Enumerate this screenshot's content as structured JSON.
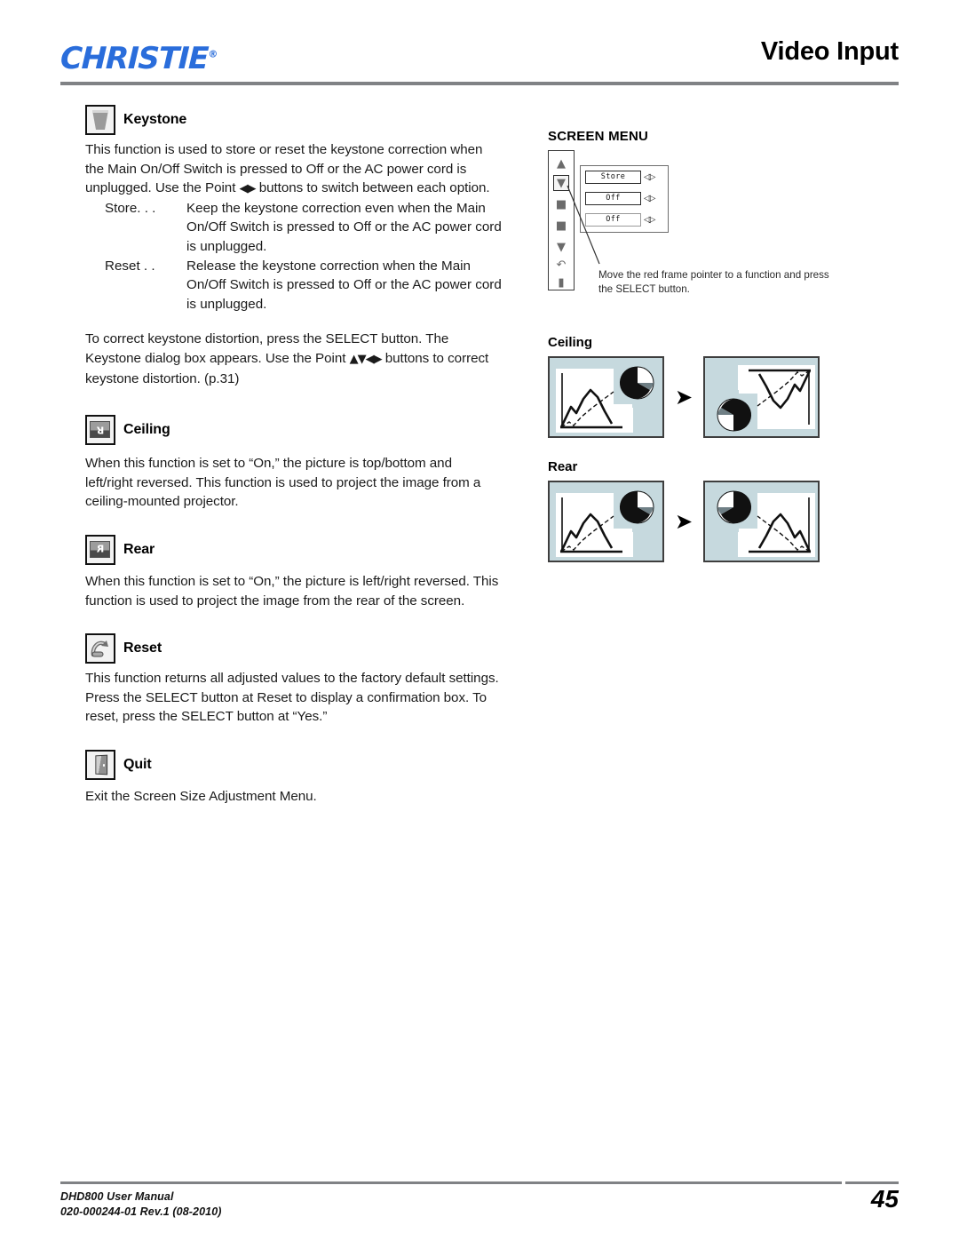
{
  "header": {
    "logo_text": "CHRISTIE",
    "logo_registered": "®",
    "title": "Video Input"
  },
  "left_column": {
    "keystone": {
      "icon": "keystone-trapezoid-icon",
      "heading": "Keystone",
      "intro": "This function is used to store or reset the keystone correction when the Main On/Off Switch is pressed to Off or the AC power cord is unplugged. Use the Point ",
      "intro_arrows": "◀▶",
      "intro_tail": " buttons to switch between each option.",
      "options": [
        {
          "term": "Store. . .",
          "desc": "Keep the keystone correction even when the Main On/Off Switch is pressed to Off or the AC power cord is unplugged."
        },
        {
          "term": "Reset . .",
          "desc": "Release the keystone correction when the Main On/Off Switch is pressed to Off or the AC power cord is unplugged."
        }
      ],
      "closing_lead": "To correct keystone distortion, press the SELECT button. The Keystone dialog box appears. Use the Point ",
      "closing_arrows": "▲▼◀▶",
      "closing_tail": " buttons to correct keystone distortion. (p.31)"
    },
    "ceiling": {
      "icon": "ceiling-screen-icon",
      "heading": "Ceiling",
      "body": "When this function is set to “On,” the picture is top/bottom and left/right reversed. This function is used to project the image from a ceiling-mounted projector."
    },
    "rear": {
      "icon": "rear-screen-icon",
      "heading": "Rear",
      "body": "When this function is set to “On,” the picture is left/right reversed. This function is used to project the image from the rear of the screen."
    },
    "reset": {
      "icon": "reset-arrow-icon",
      "heading": "Reset",
      "body": "This function returns all adjusted values to the factory default settings. Press the SELECT button at Reset to display a confirmation box. To reset, press the SELECT button at “Yes.”"
    },
    "quit": {
      "icon": "quit-door-icon",
      "heading": "Quit",
      "body": "Exit the Screen Size Adjustment Menu."
    }
  },
  "right_column": {
    "screen_menu": {
      "title": "SCREEN MENU",
      "rail_icons": [
        "up-triangle-icon",
        "keystone-trapezoid-icon",
        "ceiling-screen-icon",
        "rear-screen-icon",
        "down-triangle-icon",
        "reset-arrow-icon",
        "quit-door-icon"
      ],
      "rows": [
        {
          "value": "Store",
          "adjuster": "◁▷"
        },
        {
          "value": "Off",
          "adjuster": "◁▷"
        },
        {
          "value": "Off",
          "adjuster": "◁▷"
        }
      ],
      "caption": "Move the red frame pointer to a function and press the SELECT button."
    },
    "ceiling_illustration": {
      "title": "Ceiling",
      "arrow": "➤",
      "before_label": "normal-projection-image",
      "after_label": "ceiling-flipped-image"
    },
    "rear_illustration": {
      "title": "Rear",
      "arrow": "➤",
      "before_label": "normal-projection-image",
      "after_label": "rear-mirrored-image"
    }
  },
  "footer": {
    "line1": "DHD800 User Manual",
    "line2": "020-000244-01 Rev.1 (08-2010)",
    "page_number": "45"
  },
  "colors": {
    "brand_blue": "#2a6ddb",
    "rule_gray": "#808285",
    "panel_tint": "#c6d9de",
    "panel_border": "#3e3e3e"
  }
}
